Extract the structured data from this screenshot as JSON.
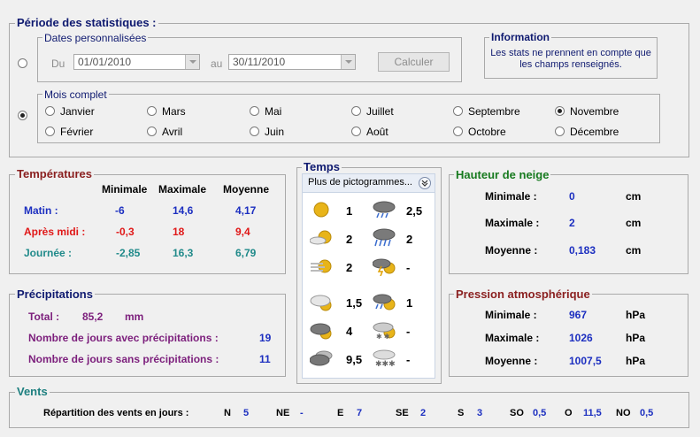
{
  "period": {
    "title": "Période des statistiques :",
    "custom_dates": {
      "legend": "Dates personnalisées",
      "from_label": "Du",
      "from_value": "01/01/2010",
      "to_label": "au",
      "to_value": "30/11/2010",
      "calc_button": "Calculer"
    },
    "info": {
      "title": "Information",
      "line1": "Les stats ne prennent en compte que",
      "line2": "les champs renseignés."
    },
    "month": {
      "legend": "Mois complet",
      "months": [
        "Janvier",
        "Mars",
        "Mai",
        "Juillet",
        "Septembre",
        "Novembre",
        "Février",
        "Avril",
        "Juin",
        "Août",
        "Octobre",
        "Décembre"
      ],
      "selected": "Novembre"
    }
  },
  "temperatures": {
    "title": "Températures",
    "headers": [
      "Minimale",
      "Maximale",
      "Moyenne"
    ],
    "rows": [
      {
        "label": "Matin :",
        "values": [
          "-6",
          "14,6",
          "4,17"
        ]
      },
      {
        "label": "Après midi :",
        "values": [
          "-0,3",
          "18",
          "9,4"
        ]
      },
      {
        "label": "Journée :",
        "values": [
          "-2,85",
          "16,3",
          "6,79"
        ]
      }
    ]
  },
  "precipitations": {
    "title": "Précipitations",
    "total_label": "Total :",
    "total_value": "85,2",
    "total_unit": "mm",
    "with_label": "Nombre de jours avec précipitations :",
    "with_value": "19",
    "without_label": "Nombre de jours sans précipitations :",
    "without_value": "11"
  },
  "weather": {
    "title": "Temps",
    "more_button": "Plus de pictogrammes...",
    "left": [
      {
        "icon": "sun-icon",
        "value": "1"
      },
      {
        "icon": "sun-cloud-icon",
        "value": "2"
      },
      {
        "icon": "sun-haze-icon",
        "value": "2"
      },
      {
        "icon": "cloud-sun-icon",
        "value": "1,5"
      },
      {
        "icon": "dark-cloud-sun-icon",
        "value": "4"
      },
      {
        "icon": "dark-clouds-icon",
        "value": "9,5"
      }
    ],
    "right": [
      {
        "icon": "rain-cloud-icon",
        "value": "2,5"
      },
      {
        "icon": "heavy-rain-icon",
        "value": "2"
      },
      {
        "icon": "thunderstorm-icon",
        "value": "-"
      },
      {
        "icon": "sun-rain-icon",
        "value": "1"
      },
      {
        "icon": "snow-cloud-icon",
        "value": "-"
      },
      {
        "icon": "snowflake-icon",
        "value": "-"
      }
    ]
  },
  "snow": {
    "title": "Hauteur de neige",
    "rows": [
      {
        "label": "Minimale :",
        "value": "0",
        "unit": "cm"
      },
      {
        "label": "Maximale :",
        "value": "2",
        "unit": "cm"
      },
      {
        "label": "Moyenne :",
        "value": "0,183",
        "unit": "cm"
      }
    ]
  },
  "pressure": {
    "title": "Pression atmosphérique",
    "rows": [
      {
        "label": "Minimale :",
        "value": "967",
        "unit": "hPa"
      },
      {
        "label": "Maximale :",
        "value": "1026",
        "unit": "hPa"
      },
      {
        "label": "Moyenne :",
        "value": "1007,5",
        "unit": "hPa"
      }
    ]
  },
  "winds": {
    "title": "Vents",
    "label": "Répartition des vents en jours :",
    "items": [
      {
        "dir": "N",
        "value": "5"
      },
      {
        "dir": "NE",
        "value": "-"
      },
      {
        "dir": "E",
        "value": "7"
      },
      {
        "dir": "SE",
        "value": "2"
      },
      {
        "dir": "S",
        "value": "3"
      },
      {
        "dir": "SO",
        "value": "0,5"
      },
      {
        "dir": "O",
        "value": "11,5"
      },
      {
        "dir": "NO",
        "value": "0,5"
      }
    ]
  }
}
